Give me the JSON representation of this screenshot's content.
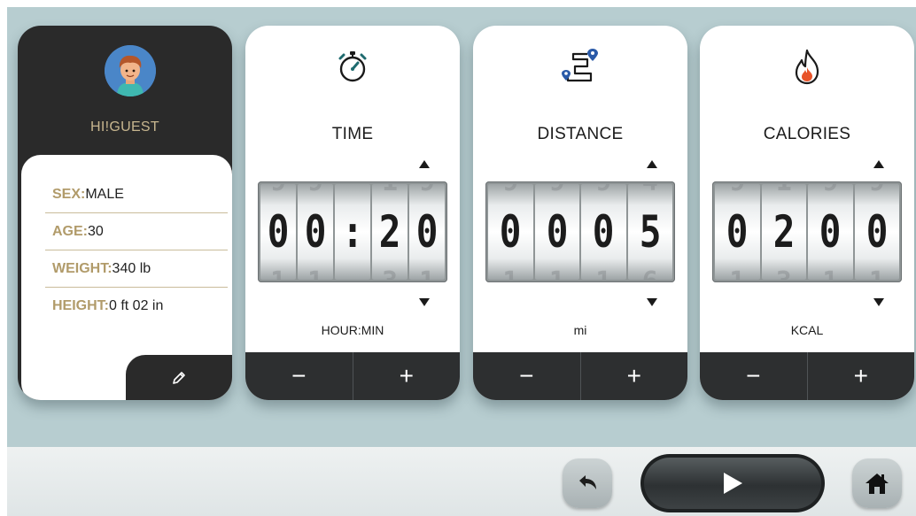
{
  "profile": {
    "greeting": "HI!GUEST",
    "rows": [
      {
        "key": "SEX:",
        "value": "MALE"
      },
      {
        "key": "AGE:",
        "value": "30"
      },
      {
        "key": "WEIGHT:",
        "value": "340 lb"
      },
      {
        "key": "HEIGHT:",
        "value": "0 ft 02 in"
      }
    ],
    "edit_icon": "pencil-icon"
  },
  "time": {
    "title": "TIME",
    "icon": "stopwatch-icon",
    "digits": [
      "0",
      "0",
      ":",
      "2",
      "0"
    ],
    "ghost_top": [
      "9",
      "9",
      "",
      "1",
      "9"
    ],
    "ghost_bottom": [
      "1",
      "1",
      "",
      "3",
      "1"
    ],
    "unit": "HOUR:MIN",
    "minus": "−",
    "plus": "+"
  },
  "distance": {
    "title": "DISTANCE",
    "icon": "route-icon",
    "digits": [
      "0",
      "0",
      "0",
      "5"
    ],
    "ghost_top": [
      "9",
      "9",
      "9",
      "4"
    ],
    "ghost_bottom": [
      "1",
      "1",
      "1",
      "6"
    ],
    "unit": "mi",
    "minus": "−",
    "plus": "+"
  },
  "calories": {
    "title": "CALORIES",
    "icon": "flame-icon",
    "digits": [
      "0",
      "2",
      "0",
      "0"
    ],
    "ghost_top": [
      "9",
      "1",
      "9",
      "9"
    ],
    "ghost_bottom": [
      "1",
      "3",
      "1",
      "1"
    ],
    "unit": "KCAL",
    "minus": "−",
    "plus": "+"
  },
  "controls": {
    "back_icon": "undo-icon",
    "play_icon": "play-icon",
    "home_icon": "home-icon"
  },
  "colors": {
    "background": "#b7cdd0",
    "dark": "#2a2a2a",
    "accent_gold": "#b19b6a",
    "icon_teal": "#1f6b6f",
    "icon_blue": "#2a5aa8",
    "flame": "#e8542a"
  }
}
